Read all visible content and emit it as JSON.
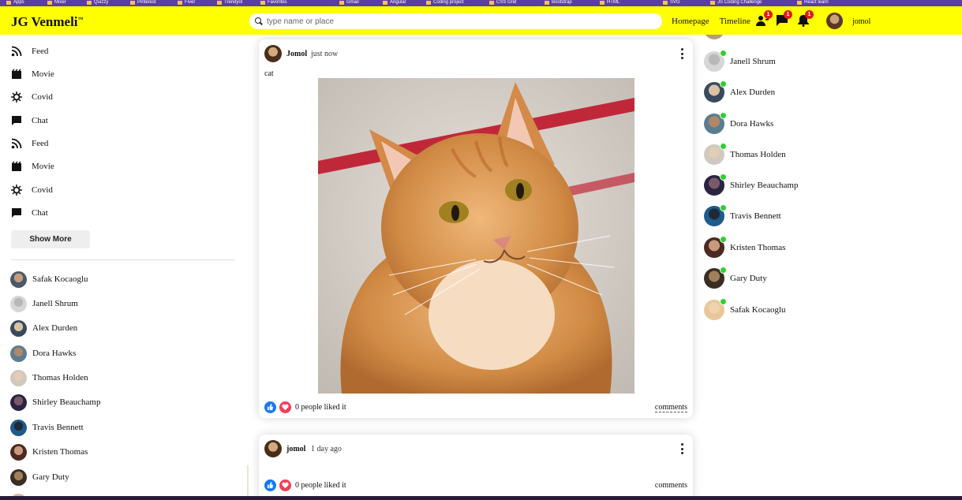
{
  "bookmarks": [
    "Apps",
    "Mixer",
    "Quizzy",
    "Pinterest",
    "Fiver",
    "Trendyol",
    "Favorites",
    "Gmail",
    "Angular",
    "Coding project",
    "CSS Grid",
    "Bootstrap",
    "HTML",
    "SVG",
    "JS Coding Challenge",
    "React learn"
  ],
  "app": {
    "logo": "JG Venmeli",
    "logo_mark": "™"
  },
  "search": {
    "placeholder": "type name or place"
  },
  "topnav": {
    "links": [
      "Homepage",
      "Timeline"
    ],
    "badges": {
      "friends": "1",
      "messages": "1",
      "notifications": "1"
    },
    "username": "jomol"
  },
  "sidebar": {
    "items": [
      {
        "label": "Feed",
        "icon": "rss-icon"
      },
      {
        "label": "Movie",
        "icon": "clapperboard-icon"
      },
      {
        "label": "Covid",
        "icon": "virus-icon"
      },
      {
        "label": "Chat",
        "icon": "chat-bubble-icon"
      },
      {
        "label": "Feed",
        "icon": "rss-icon"
      },
      {
        "label": "Movie",
        "icon": "clapperboard-icon"
      },
      {
        "label": "Covid",
        "icon": "virus-icon"
      },
      {
        "label": "Chat",
        "icon": "chat-bubble-icon"
      }
    ],
    "show_more": "Show More",
    "friends": [
      "Safak Kocaoglu",
      "Janell Shrum",
      "Alex Durden",
      "Dora Hawks",
      "Thomas Holden",
      "Shirley Beauchamp",
      "Travis Bennett",
      "Kristen Thomas",
      "Gary Duty"
    ]
  },
  "posts": [
    {
      "user": "Jomol",
      "time": "just now",
      "text": "cat",
      "image": "orange-tabby-cat-photo",
      "likes": "0 people liked it",
      "comments": "comments"
    },
    {
      "user": "jomol",
      "time": "1 day ago",
      "text": "",
      "likes": "0 people liked it",
      "comments": "comments"
    }
  ],
  "rightbar": {
    "online": [
      "Janell Shrum",
      "Alex Durden",
      "Dora Hawks",
      "Thomas Holden",
      "Shirley Beauchamp",
      "Travis Bennett",
      "Kristen Thomas",
      "Gary Duty",
      "Safak Kocaoglu"
    ]
  },
  "colors": {
    "topbar": "#ffff00",
    "online_dot": "#32cd32",
    "like": "#1877f2",
    "love": "#f33e58",
    "badge": "#e21b1b"
  }
}
